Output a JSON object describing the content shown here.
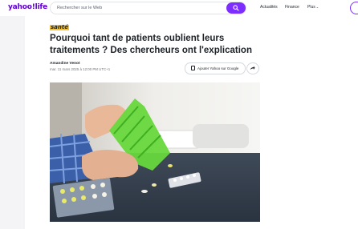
{
  "header": {
    "logo": "yahoo!life",
    "search_placeholder": "Rechercher sur le Web",
    "nav": [
      "Actualités",
      "Finance",
      "Plus"
    ]
  },
  "article": {
    "section": "santé",
    "title": "Pourquoi tant de patients oublient leurs traitements ? Des chercheurs ont l'explication",
    "author": "Amandine Venot",
    "date": "mar. 11 mars 2025 à 12:00 PM UTC+1",
    "google_button": "Ajouter Yahoo sur Google"
  },
  "colors": {
    "brand": "#6001d2",
    "search_button": "#7d2eff",
    "section_highlight": "#f5c33b"
  },
  "icons": [
    "search-icon",
    "bookmark-icon",
    "share-icon"
  ],
  "image": "hands opening green pill organizer on a table with pill blister packs"
}
